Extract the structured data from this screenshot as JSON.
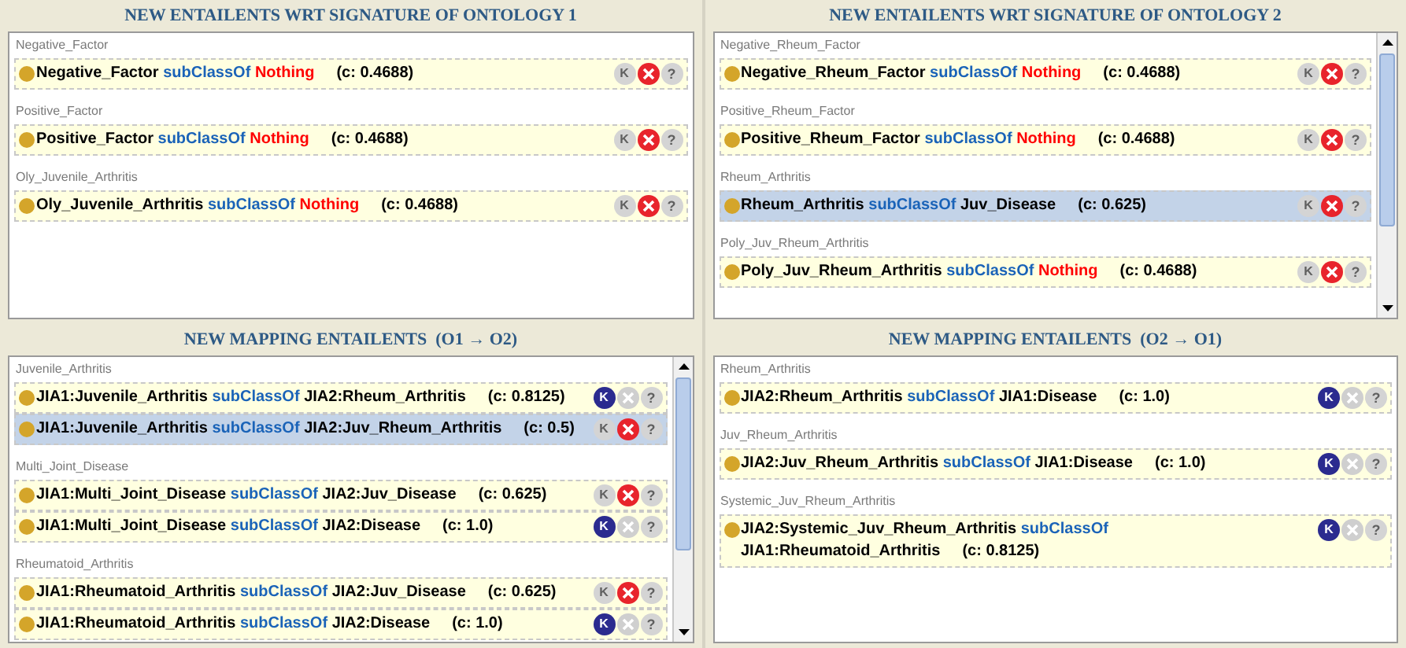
{
  "panels": [
    {
      "title": "NEW ENTAILENTS WRT SIGNATURE OF ONTOLOGY 1",
      "scrollbar": false,
      "groups": [
        {
          "label": "Negative_Factor",
          "axioms": [
            {
              "subject": "Negative_Factor",
              "relation": "subClassOf",
              "object": "Nothing",
              "kind": "nothing",
              "confidence": "(c: 0.4688)",
              "selected": false,
              "keep": false,
              "remove": true,
              "keep_label": "K",
              "help_label": "?"
            }
          ]
        },
        {
          "label": "Positive_Factor",
          "axioms": [
            {
              "subject": "Positive_Factor",
              "relation": "subClassOf",
              "object": "Nothing",
              "kind": "nothing",
              "confidence": "(c: 0.4688)",
              "selected": false,
              "keep": false,
              "remove": true,
              "keep_label": "K",
              "help_label": "?"
            }
          ]
        },
        {
          "label": "Oly_Juvenile_Arthritis",
          "axioms": [
            {
              "subject": "Oly_Juvenile_Arthritis",
              "relation": "subClassOf",
              "object": "Nothing",
              "kind": "nothing",
              "confidence": "(c: 0.4688)",
              "selected": false,
              "keep": false,
              "remove": true,
              "keep_label": "K",
              "help_label": "?"
            }
          ]
        }
      ]
    },
    {
      "title": "NEW ENTAILENTS WRT SIGNATURE OF ONTOLOGY 2",
      "scrollbar": true,
      "groups": [
        {
          "label": "Negative_Rheum_Factor",
          "axioms": [
            {
              "subject": "Negative_Rheum_Factor",
              "relation": "subClassOf",
              "object": "Nothing",
              "kind": "nothing",
              "confidence": "(c: 0.4688)",
              "selected": false,
              "keep": false,
              "remove": true,
              "keep_label": "K",
              "help_label": "?"
            }
          ]
        },
        {
          "label": "Positive_Rheum_Factor",
          "axioms": [
            {
              "subject": "Positive_Rheum_Factor",
              "relation": "subClassOf",
              "object": "Nothing",
              "kind": "nothing",
              "confidence": "(c: 0.4688)",
              "selected": false,
              "keep": false,
              "remove": true,
              "keep_label": "K",
              "help_label": "?"
            }
          ]
        },
        {
          "label": "Rheum_Arthritis",
          "axioms": [
            {
              "subject": "Rheum_Arthritis",
              "relation": "subClassOf",
              "object": "Juv_Disease",
              "kind": "class",
              "confidence": "(c: 0.625)",
              "selected": true,
              "keep": false,
              "remove": true,
              "keep_label": "K",
              "help_label": "?"
            }
          ]
        },
        {
          "label": "Poly_Juv_Rheum_Arthritis",
          "axioms": [
            {
              "subject": "Poly_Juv_Rheum_Arthritis",
              "relation": "subClassOf",
              "object": "Nothing",
              "kind": "nothing",
              "confidence": "(c: 0.4688)",
              "selected": false,
              "keep": false,
              "remove": true,
              "keep_label": "K",
              "help_label": "?"
            }
          ]
        }
      ]
    },
    {
      "title": "NEW MAPPING ENTAILENTS  (O1 → O2)",
      "scrollbar": true,
      "groups": [
        {
          "label": "Juvenile_Arthritis",
          "axioms": [
            {
              "subject": "JIA1:Juvenile_Arthritis",
              "relation": "subClassOf",
              "object": "JIA2:Rheum_Arthritis",
              "kind": "class",
              "confidence": "(c: 0.8125)",
              "selected": false,
              "keep": true,
              "remove": false,
              "keep_label": "K",
              "help_label": "?"
            },
            {
              "subject": "JIA1:Juvenile_Arthritis",
              "relation": "subClassOf",
              "object": "JIA2:Juv_Rheum_Arthritis",
              "kind": "class",
              "confidence": "(c: 0.5)",
              "selected": true,
              "keep": false,
              "remove": true,
              "keep_label": "K",
              "help_label": "?"
            }
          ]
        },
        {
          "label": "Multi_Joint_Disease",
          "axioms": [
            {
              "subject": "JIA1:Multi_Joint_Disease",
              "relation": "subClassOf",
              "object": "JIA2:Juv_Disease",
              "kind": "class",
              "confidence": "(c: 0.625)",
              "selected": false,
              "keep": false,
              "remove": true,
              "keep_label": "K",
              "help_label": "?"
            },
            {
              "subject": "JIA1:Multi_Joint_Disease",
              "relation": "subClassOf",
              "object": "JIA2:Disease",
              "kind": "class",
              "confidence": "(c: 1.0)",
              "selected": false,
              "keep": true,
              "remove": false,
              "keep_label": "K",
              "help_label": "?"
            }
          ]
        },
        {
          "label": "Rheumatoid_Arthritis",
          "axioms": [
            {
              "subject": "JIA1:Rheumatoid_Arthritis",
              "relation": "subClassOf",
              "object": "JIA2:Juv_Disease",
              "kind": "class",
              "confidence": "(c: 0.625)",
              "selected": false,
              "keep": false,
              "remove": true,
              "keep_label": "K",
              "help_label": "?"
            },
            {
              "subject": "JIA1:Rheumatoid_Arthritis",
              "relation": "subClassOf",
              "object": "JIA2:Disease",
              "kind": "class",
              "confidence": "(c: 1.0)",
              "selected": false,
              "keep": true,
              "remove": false,
              "keep_label": "K",
              "help_label": "?"
            }
          ]
        }
      ]
    },
    {
      "title": "NEW MAPPING ENTAILENTS  (O2 → O1)",
      "scrollbar": false,
      "groups": [
        {
          "label": "Rheum_Arthritis",
          "axioms": [
            {
              "subject": "JIA2:Rheum_Arthritis",
              "relation": "subClassOf",
              "object": "JIA1:Disease",
              "kind": "class",
              "confidence": "(c: 1.0)",
              "selected": false,
              "keep": true,
              "remove": false,
              "keep_label": "K",
              "help_label": "?"
            }
          ]
        },
        {
          "label": "Juv_Rheum_Arthritis",
          "axioms": [
            {
              "subject": "JIA2:Juv_Rheum_Arthritis",
              "relation": "subClassOf",
              "object": "JIA1:Disease",
              "kind": "class",
              "confidence": "(c: 1.0)",
              "selected": false,
              "keep": true,
              "remove": false,
              "keep_label": "K",
              "help_label": "?"
            }
          ]
        },
        {
          "label": "Systemic_Juv_Rheum_Arthritis",
          "axioms": [
            {
              "subject": "JIA2:Systemic_Juv_Rheum_Arthritis",
              "relation": "subClassOf",
              "object": "JIA1:Rheumatoid_Arthritis",
              "kind": "class",
              "confidence": "(c: 0.8125)",
              "selected": false,
              "keep": true,
              "remove": false,
              "keep_label": "K",
              "help_label": "?"
            }
          ]
        }
      ]
    }
  ]
}
